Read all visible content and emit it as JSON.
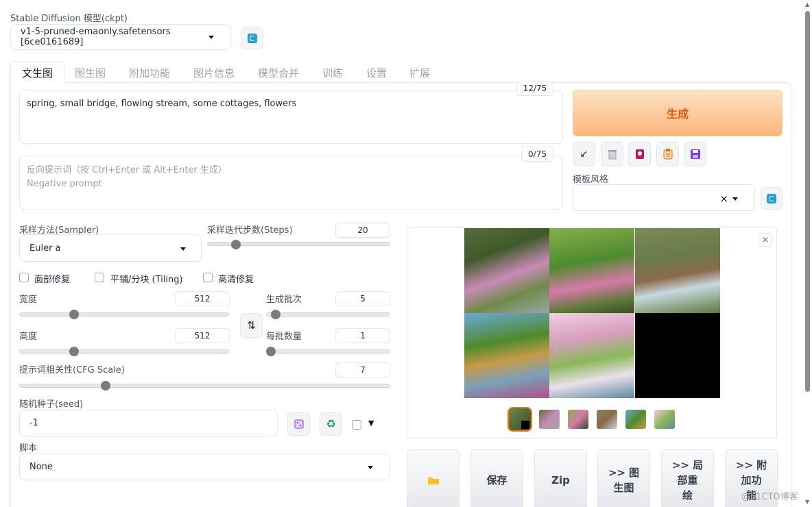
{
  "model": {
    "label": "Stable Diffusion 模型(ckpt)",
    "selected": "v1-5-pruned-emaonly.safetensors [6ce0161689]"
  },
  "tabs": [
    "文生图",
    "图生图",
    "附加功能",
    "图片信息",
    "模型合并",
    "训练",
    "设置",
    "扩展"
  ],
  "prompt": {
    "value": "spring, small bridge, flowing stream, some cottages, flowers",
    "counter": "12/75"
  },
  "negative_prompt": {
    "placeholder_line1": "反向提示词（按 Ctrl+Enter 或 Alt+Enter 生成）",
    "placeholder_line2": "Negative prompt",
    "counter": "0/75"
  },
  "generate": {
    "label": "生成"
  },
  "style": {
    "label": "模板风格",
    "clear": "×"
  },
  "sampler": {
    "label": "采样方法(Sampler)",
    "selected": "Euler a"
  },
  "steps": {
    "label": "采样迭代步数(Steps)",
    "value": "20",
    "fraction": 0.13
  },
  "checkboxes": {
    "face_restore": "面部修复",
    "tiling": "平铺/分块 (Tiling)",
    "hires": "高清修复"
  },
  "width": {
    "label": "宽度",
    "value": "512",
    "fraction": 0.24
  },
  "height": {
    "label": "高度",
    "value": "512",
    "fraction": 0.24
  },
  "swap": {
    "icon": "⇅"
  },
  "batch_count": {
    "label": "生成批次",
    "value": "5",
    "fraction": 0.04
  },
  "batch_size": {
    "label": "每批数量",
    "value": "1",
    "fraction": 0.0
  },
  "cfg": {
    "label": "提示词相关性(CFG Scale)",
    "value": "7",
    "fraction": 0.22
  },
  "seed": {
    "label": "随机种子(seed)",
    "value": "-1"
  },
  "script": {
    "label": "脚本",
    "selected": "None"
  },
  "gallery": {
    "close": "×"
  },
  "actions": {
    "save": "保存",
    "zip": "Zip",
    "to_img2img": ">> 图\n生图",
    "to_inpaint": ">> 局\n部重\n绘",
    "to_extras": ">> 附\n加功\n能"
  },
  "watermark": "@51CTO博客",
  "colors": {
    "generate_bg": "#fbbf7f",
    "generate_text": "#ea580c",
    "accent_refresh": "#1e9fd8",
    "selected_thumb_border": "#f97316"
  }
}
